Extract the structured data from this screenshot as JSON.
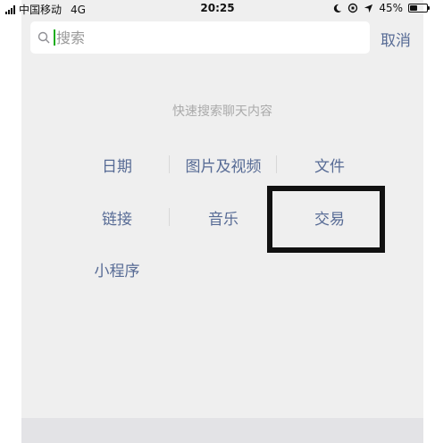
{
  "status_bar": {
    "carrier": "中国移动",
    "network": "4G",
    "time": "20:25",
    "battery": "45%",
    "battery_level": 0.45
  },
  "search": {
    "placeholder": "搜索",
    "cancel_label": "取消"
  },
  "quick_search": {
    "title": "快速搜索聊天内容",
    "items": [
      "日期",
      "图片及视频",
      "文件",
      "链接",
      "音乐",
      "交易",
      "小程序"
    ]
  },
  "colors": {
    "link": "#576b95",
    "caret": "#1aad19",
    "background": "#efefef",
    "highlight": "#111111"
  }
}
